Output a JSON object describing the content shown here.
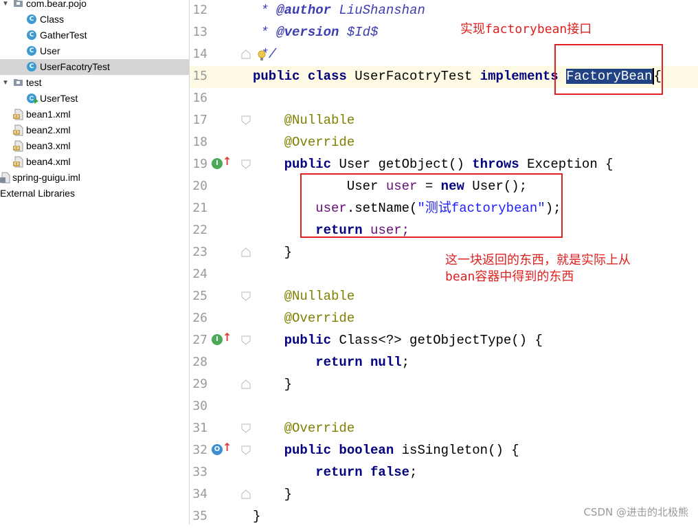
{
  "project_tree": {
    "items": [
      {
        "label": "com.bear.pojo",
        "kind": "package",
        "expanded": true
      },
      {
        "label": "Class",
        "kind": "class"
      },
      {
        "label": "GatherTest",
        "kind": "class"
      },
      {
        "label": "User",
        "kind": "class"
      },
      {
        "label": "UserFacotryTest",
        "kind": "class",
        "selected": true
      },
      {
        "label": "test",
        "kind": "package",
        "expanded": true
      },
      {
        "label": "UserTest",
        "kind": "test-class"
      },
      {
        "label": "bean1.xml",
        "kind": "xml"
      },
      {
        "label": "bean2.xml",
        "kind": "xml"
      },
      {
        "label": "bean3.xml",
        "kind": "xml"
      },
      {
        "label": "bean4.xml",
        "kind": "xml"
      },
      {
        "label": "spring-guigu.iml",
        "kind": "iml"
      },
      {
        "label": "External Libraries",
        "kind": "libraries"
      }
    ],
    "class_icon_letter": "C"
  },
  "editor": {
    "line_numbers": [
      "12",
      "13",
      "14",
      "15",
      "16",
      "17",
      "18",
      "19",
      "20",
      "21",
      "22",
      "23",
      "24",
      "25",
      "26",
      "27",
      "28",
      "29",
      "30",
      "31",
      "32",
      "33",
      "34",
      "35"
    ],
    "lines": {
      "l12": {
        "star": "*",
        "tag": "@author",
        "text": "LiuShanshan"
      },
      "l13": {
        "star": "*",
        "tag": "@version",
        "text": "$Id$"
      },
      "l14": {
        "text": "*/"
      },
      "l15": {
        "kw1": "public class",
        "name": "UserFacotryTest",
        "kw2": "implements",
        "selected": "FactoryBean",
        "brace": "{"
      },
      "l17": {
        "anno": "@Nullable"
      },
      "l18": {
        "anno": "@Override"
      },
      "l19": {
        "kw1": "public",
        "type": "User getObject()",
        "kw2": "throws",
        "rest": "Exception {"
      },
      "l20": {
        "type": "User",
        "var": "user",
        "eq": "=",
        "kw": "new",
        "rest": "User();"
      },
      "l21": {
        "var": "user",
        "call": ".setName(",
        "str": "\"测试factorybean\"",
        "end": ");"
      },
      "l22": {
        "kw": "return",
        "var": "user;"
      },
      "l23": {
        "text": "}"
      },
      "l25": {
        "anno": "@Nullable"
      },
      "l26": {
        "anno": "@Override"
      },
      "l27": {
        "kw1": "public",
        "rest": "Class<?> getObjectType() {"
      },
      "l28": {
        "kw": "return null",
        "end": ";"
      },
      "l29": {
        "text": "}"
      },
      "l31": {
        "anno": "@Override"
      },
      "l32": {
        "kw1": "public boolean",
        "rest": "isSingleton() {"
      },
      "l33": {
        "kw": "return false",
        "end": ";"
      },
      "l34": {
        "text": "}"
      },
      "l35": {
        "text": "}"
      }
    },
    "gutter_markers": [
      {
        "line": "19",
        "letter": "I",
        "color": "#4caa5a"
      },
      {
        "line": "27",
        "letter": "I",
        "color": "#4caa5a"
      },
      {
        "line": "32",
        "letter": "O",
        "color": "#3d8fd1"
      }
    ]
  },
  "annotations": {
    "note1": "实现factorybean接口",
    "note2_line1": "这一块返回的东西，就是实际上从",
    "note2_line2": "bean容器中得到的东西",
    "color": "#e02020"
  },
  "watermark": "CSDN @进击的北极熊",
  "colors": {
    "keyword": "#000080",
    "annotation": "#808000",
    "doc": "#3c3cb4",
    "string": "#2020ff",
    "selection": "#214283",
    "current_line": "#fffae3"
  }
}
